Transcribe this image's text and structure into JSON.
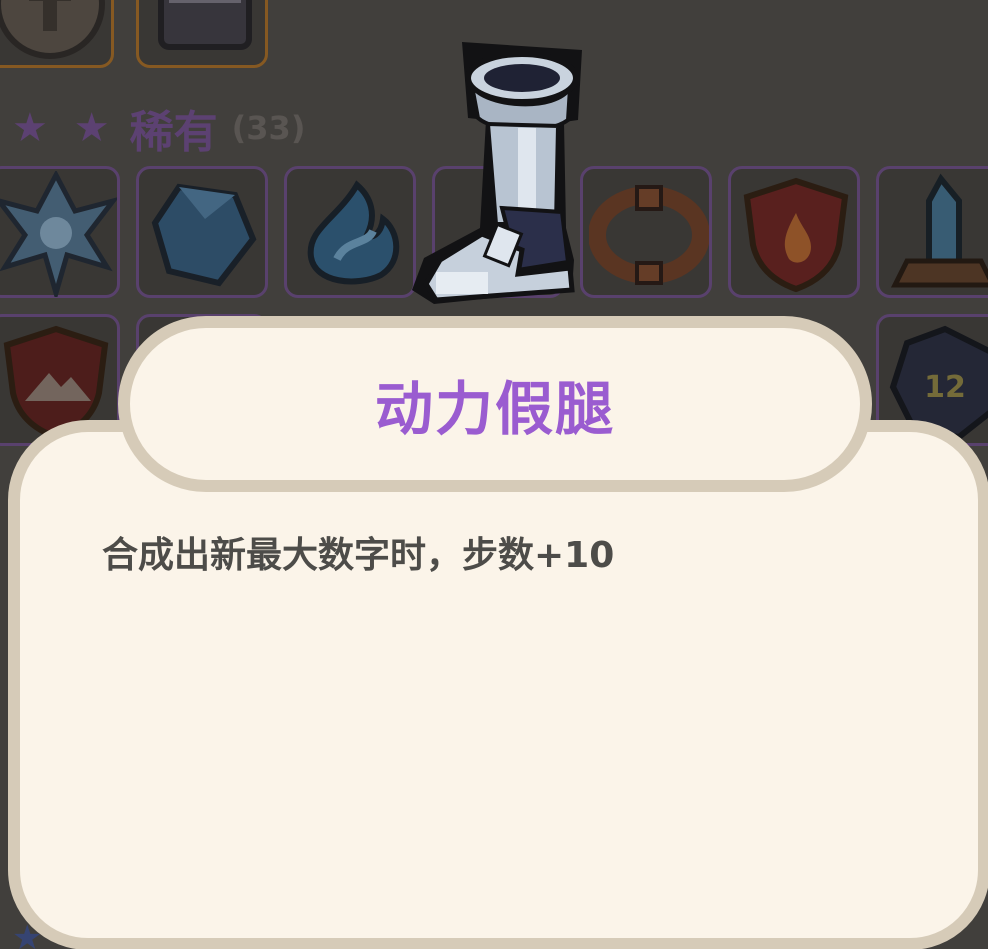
{
  "collection": {
    "rare_section": {
      "stars": "★ ★",
      "name": "稀有",
      "count": "(33)"
    },
    "next_section_stars": "★"
  },
  "item_dialog": {
    "title": "动力假腿",
    "description": "合成出新最大数字时，步数+10",
    "icon": "mechanical-leg-icon"
  },
  "colors": {
    "title": "#9a5cd0",
    "description": "#4d4c49",
    "card_bg": "#fbf4e9",
    "card_border": "#d6cbb8",
    "rare_border": "#6a4a86"
  }
}
